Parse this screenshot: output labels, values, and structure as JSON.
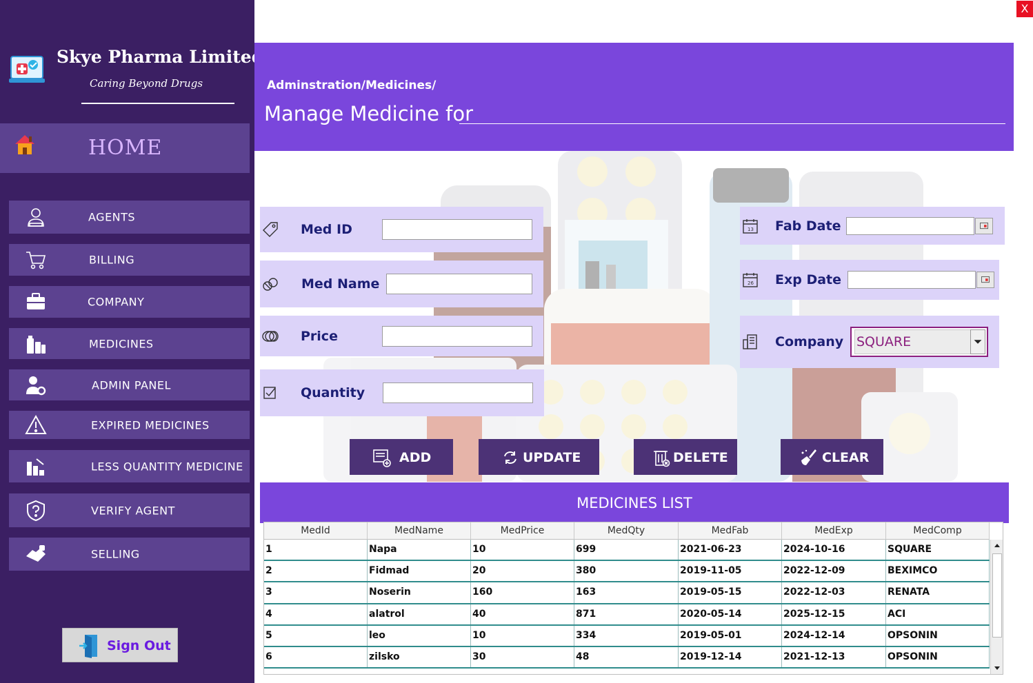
{
  "window": {
    "close_label": "X"
  },
  "brand": {
    "name": "Skye Pharma Limited",
    "tagline": "Caring Beyond Drugs"
  },
  "sidebar": {
    "home_label": "HOME",
    "items": [
      {
        "label": "AGENTS",
        "icon": "agents-icon"
      },
      {
        "label": "BILLING",
        "icon": "cart-icon"
      },
      {
        "label": "COMPANY",
        "icon": "briefcase-icon"
      },
      {
        "label": "MEDICINES",
        "icon": "medicines-icon"
      },
      {
        "label": "ADMIN PANEL",
        "icon": "admin-icon"
      },
      {
        "label": "EXPIRED MEDICINES",
        "icon": "warning-icon"
      },
      {
        "label": "LESS QUANTITY MEDICINE",
        "icon": "bar-chart-icon"
      },
      {
        "label": "VERIFY AGENT",
        "icon": "shield-icon"
      },
      {
        "label": "SELLING",
        "icon": "handshake-icon"
      }
    ],
    "signout_label": "Sign Out"
  },
  "header": {
    "breadcrumb": "Adminstration/Medicines/",
    "title": "Manage Medicine for"
  },
  "form": {
    "med_id": {
      "label": "Med ID",
      "value": ""
    },
    "med_name": {
      "label": "Med Name",
      "value": ""
    },
    "price": {
      "label": "Price",
      "value": ""
    },
    "quantity": {
      "label": "Quantity",
      "value": ""
    },
    "fab_date": {
      "label": "Fab Date",
      "value": ""
    },
    "exp_date": {
      "label": "Exp Date",
      "value": ""
    },
    "company": {
      "label": "Company",
      "value": "SQUARE"
    }
  },
  "actions": {
    "add": "ADD",
    "update": "UPDATE",
    "delete": "DELETE",
    "clear": "CLEAR"
  },
  "list": {
    "title": "MEDICINES LIST",
    "columns": [
      "MedId",
      "MedName",
      "MedPrice",
      "MedQty",
      "MedFab",
      "MedExp",
      "MedComp"
    ],
    "rows": [
      [
        "1",
        "Napa",
        "10",
        "699",
        "2021-06-23",
        "2024-10-16",
        "SQUARE"
      ],
      [
        "2",
        "Fidmad",
        "20",
        "380",
        "2019-11-05",
        "2022-12-09",
        "BEXIMCO"
      ],
      [
        "3",
        "Noserin",
        "160",
        "163",
        "2019-05-15",
        "2022-12-03",
        "RENATA"
      ],
      [
        "4",
        "alatrol",
        "40",
        "871",
        "2020-05-14",
        "2025-12-15",
        "ACI"
      ],
      [
        "5",
        "leo",
        "10",
        "334",
        "2019-05-01",
        "2024-12-14",
        "OPSONIN"
      ],
      [
        "6",
        "zilsko",
        "30",
        "48",
        "2019-12-14",
        "2021-12-13",
        "OPSONIN"
      ]
    ]
  },
  "colors": {
    "sidebar_bg": "#3b1f63",
    "sidebar_item": "#5c4290",
    "accent": "#7a46dc",
    "form_panel": "#dcd3f9",
    "label_text": "#1c1f75",
    "button_bg": "#4c3276",
    "company_text": "#8b1f7e"
  }
}
